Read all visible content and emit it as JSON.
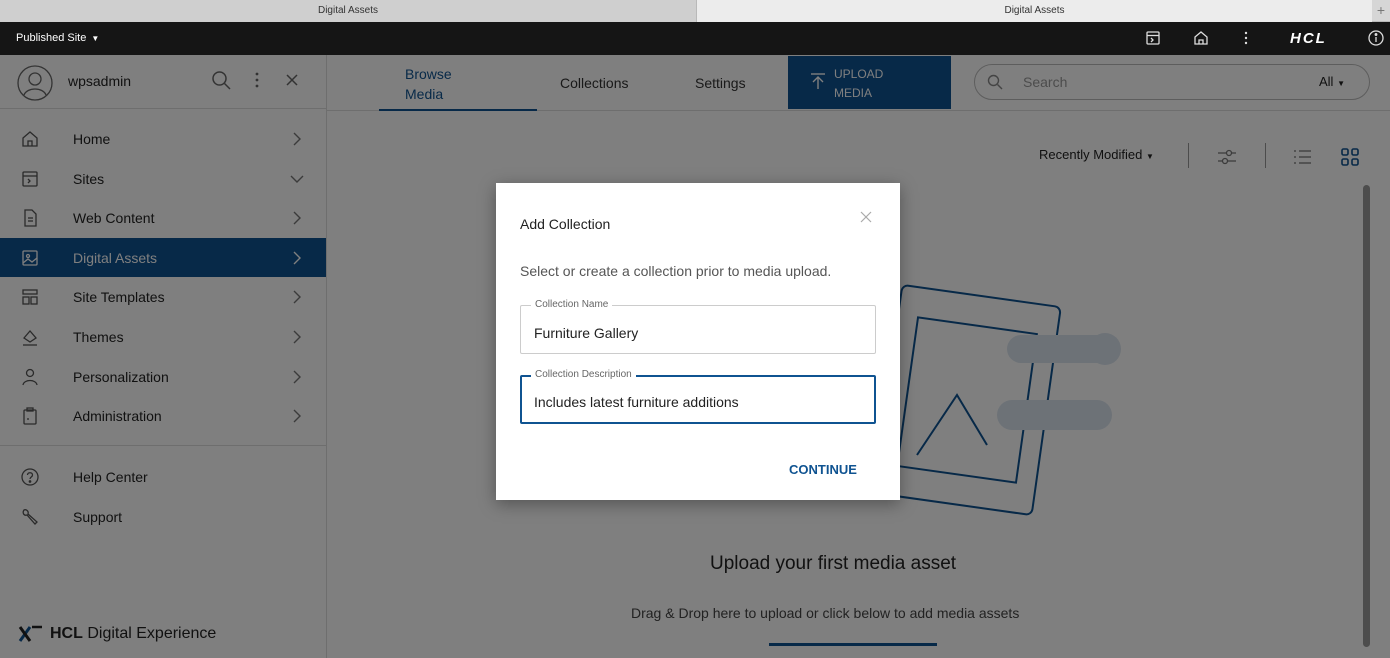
{
  "browser": {
    "tabs": [
      {
        "label": "Digital Assets"
      },
      {
        "label": "Digital Assets"
      }
    ],
    "add_tab": "+"
  },
  "topbar": {
    "site_selector": "Published Site",
    "brand_logo": "HCL",
    "icons": [
      "preview-icon",
      "home-icon",
      "more-vert-icon",
      "info-icon"
    ]
  },
  "sidebar": {
    "username": "wpsadmin",
    "items": [
      {
        "label": "Home",
        "icon": "home-icon",
        "chevron": "right"
      },
      {
        "label": "Sites",
        "icon": "sites-icon",
        "chevron": "down"
      },
      {
        "label": "Web Content",
        "icon": "document-icon",
        "chevron": "right"
      },
      {
        "label": "Digital Assets",
        "icon": "image-icon",
        "chevron": "right",
        "active": true
      },
      {
        "label": "Site Templates",
        "icon": "template-icon",
        "chevron": "right"
      },
      {
        "label": "Themes",
        "icon": "paint-icon",
        "chevron": "right"
      },
      {
        "label": "Personalization",
        "icon": "person-icon",
        "chevron": "right"
      },
      {
        "label": "Administration",
        "icon": "clipboard-icon",
        "chevron": "right"
      }
    ],
    "secondary": [
      {
        "label": "Help Center",
        "icon": "help-icon"
      },
      {
        "label": "Support",
        "icon": "wrench-icon"
      }
    ],
    "brand": {
      "bold": "HCL",
      "rest": "Digital Experience"
    }
  },
  "main": {
    "tabs": {
      "browse_media": "Browse Media",
      "collections": "Collections",
      "settings": "Settings"
    },
    "upload_button": "UPLOAD MEDIA",
    "search": {
      "placeholder": "Search",
      "filter": "All"
    },
    "sort": "Recently Modified",
    "empty_title": "Upload your first media asset",
    "empty_subtitle": "Drag & Drop here to upload or click below to add media assets"
  },
  "dialog": {
    "title": "Add Collection",
    "description": "Select or create a collection prior to media upload.",
    "name_label": "Collection Name",
    "name_value": "Furniture Gallery",
    "desc_label": "Collection Description",
    "desc_value": "Includes latest furniture additions",
    "continue": "CONTINUE"
  },
  "colors": {
    "primary": "#0f5391",
    "topbar": "#151515",
    "overlay": "rgba(0,0,0,0.5)"
  }
}
